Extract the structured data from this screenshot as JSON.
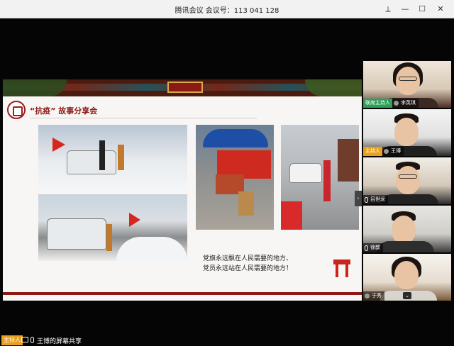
{
  "window": {
    "title": "腾讯会议  会议号：113 041 128",
    "controls": {
      "pin": "⟂",
      "minimize": "—",
      "maximize": "☐",
      "close": "✕"
    }
  },
  "slide": {
    "heading": "“抗疫” 故事分享会",
    "slogan_line1": "党旗永远飘在人民需要的地方、",
    "slogan_line2": "党员永远站在人民需要的地方！",
    "expand_arrow": "›"
  },
  "participants": [
    {
      "role": "联席主持人",
      "name": "李英琪"
    },
    {
      "role": "主持人",
      "name": "王博"
    },
    {
      "role": "",
      "name": "吕世龙"
    },
    {
      "role": "",
      "name": "徐歆"
    },
    {
      "role": "",
      "name": "于秀"
    }
  ],
  "tile_chevron": "⌄",
  "bottom_bar": {
    "role": "主持人",
    "share_label": "王博的屏幕共享"
  },
  "colors": {
    "host_green": "#2e9e58",
    "host_orange": "#e8a020",
    "accent_red": "#8b1a14"
  }
}
